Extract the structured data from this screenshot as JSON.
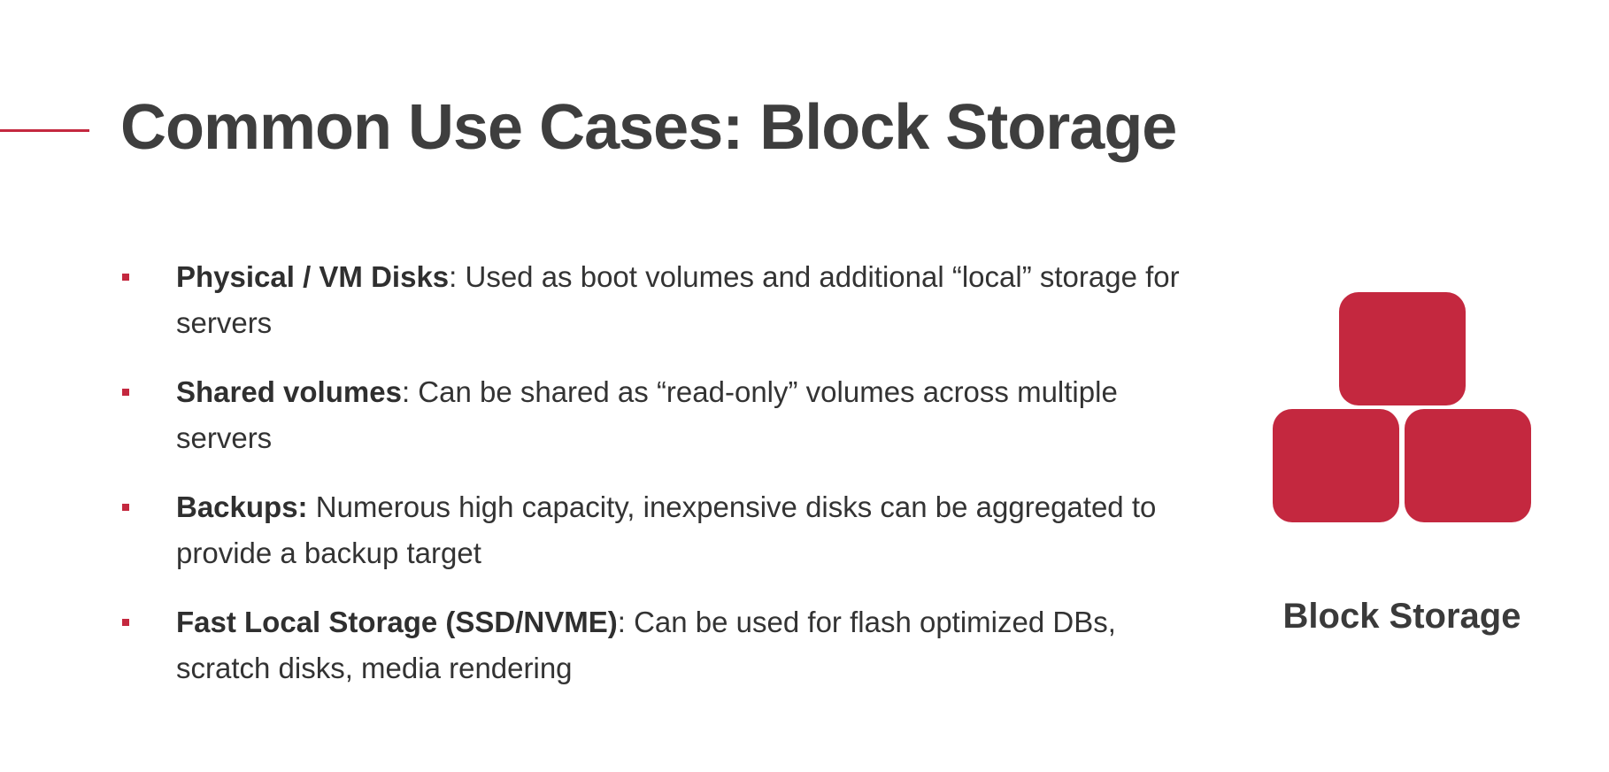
{
  "slide": {
    "title": "Common Use Cases: Block Storage",
    "bullets": [
      {
        "term": "Physical / VM Disks",
        "text": ": Used as boot volumes and additional “local” storage for servers"
      },
      {
        "term": "Shared volumes",
        "text": ": Can be shared as “read-only” volumes across multiple servers"
      },
      {
        "term": "Backups:",
        "text": " Numerous high capacity, inexpensive disks can be aggregated to provide a backup target"
      },
      {
        "term": "Fast Local Storage (SSD/NVME)",
        "text": ": Can be used for flash optimized DBs, scratch disks, media rendering"
      }
    ],
    "icon": {
      "name": "block-storage-icon",
      "caption": "Block Storage"
    },
    "colors": {
      "accent": "#c4283f",
      "title": "#3e3e3e",
      "body": "#333333"
    }
  }
}
